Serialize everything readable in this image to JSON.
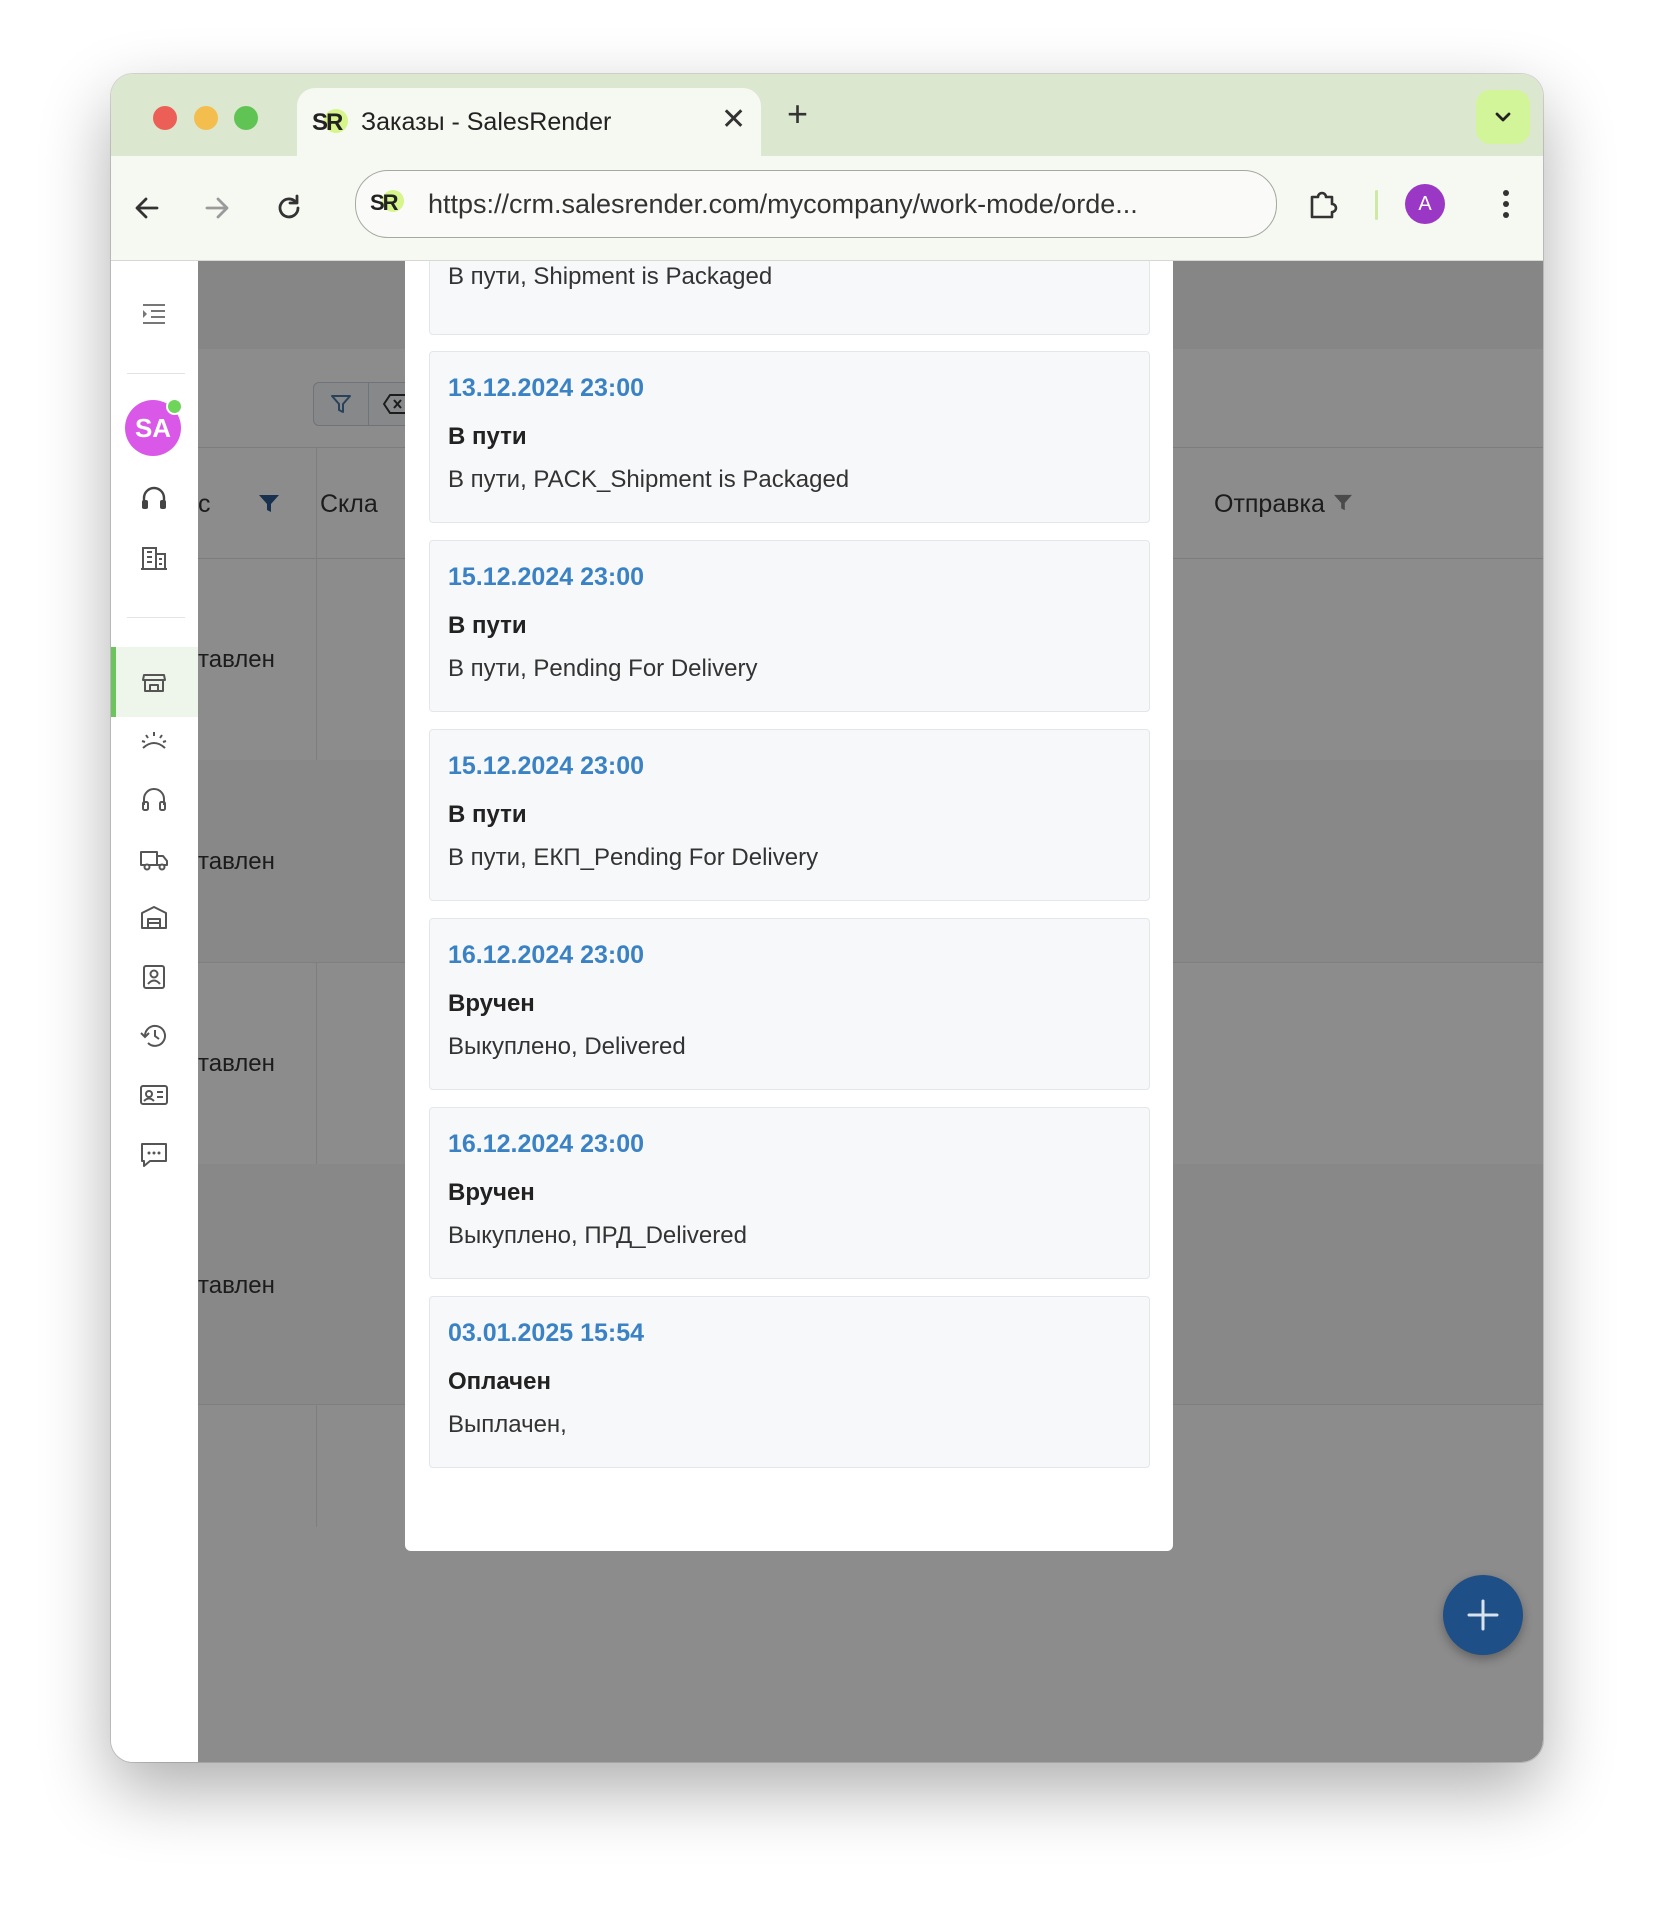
{
  "browser": {
    "tab_title": "Заказы - SalesRender",
    "tab_logo_text": "SR",
    "url": "https://crm.salesrender.com/mycompany/work-mode/orde...",
    "profile_initial": "A"
  },
  "sidebar": {
    "user_initials": "SA",
    "items": [
      "menu-toggle",
      "support",
      "company",
      "orders",
      "leads",
      "operators",
      "delivery",
      "warehouses",
      "contacts",
      "history",
      "id-cards",
      "messages"
    ]
  },
  "background": {
    "col_status_fragment": "с",
    "col_warehouse_fragment": "Скла",
    "col_shipping": "Отправка",
    "row_cells": [
      "тавлен",
      "тавлен",
      "тавлен",
      "тавлен"
    ]
  },
  "timeline": {
    "partial_top_desc": "В пути, Shipment is Packaged",
    "entries": [
      {
        "date": "13.12.2024 23:00",
        "status": "В пути",
        "desc": "В пути, PACK_Shipment is Packaged"
      },
      {
        "date": "15.12.2024 23:00",
        "status": "В пути",
        "desc": "В пути, Pending For Delivery"
      },
      {
        "date": "15.12.2024 23:00",
        "status": "В пути",
        "desc": "В пути, ЕКП_Pending For Delivery"
      },
      {
        "date": "16.12.2024 23:00",
        "status": "Вручен",
        "desc": "Выкуплено, Delivered"
      },
      {
        "date": "16.12.2024 23:00",
        "status": "Вручен",
        "desc": "Выкуплено, ПРД_Delivered"
      },
      {
        "date": "03.01.2025 15:54",
        "status": "Оплачен",
        "desc": "Выплачен,"
      }
    ]
  },
  "colors": {
    "date_accent": "#3b82c4",
    "active_nav": "#6cc45c",
    "fab": "#1e4f86",
    "avatar": "#da58e8",
    "profile": "#9a37c4"
  }
}
